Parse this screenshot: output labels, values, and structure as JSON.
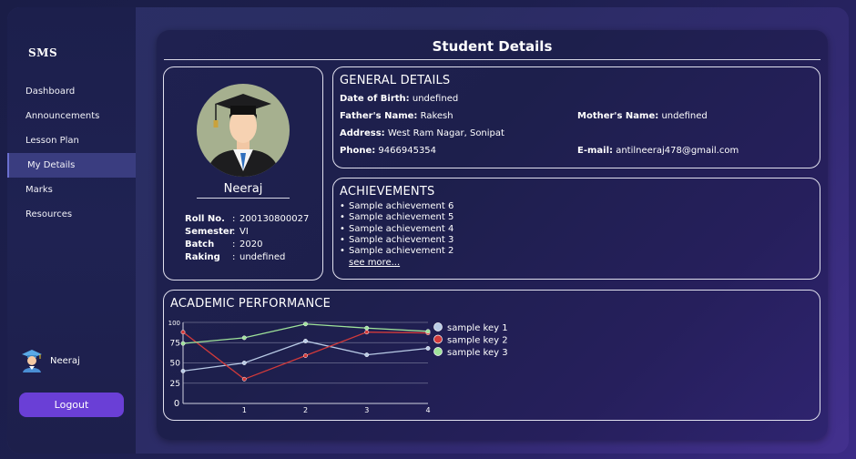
{
  "sidebar": {
    "brand": "SMS",
    "items": [
      {
        "label": "Dashboard"
      },
      {
        "label": "Announcements"
      },
      {
        "label": "Lesson Plan"
      },
      {
        "label": "My Details"
      },
      {
        "label": "Marks"
      },
      {
        "label": "Resources"
      }
    ],
    "active_index": 3,
    "user_name": "Neeraj",
    "logout_label": "Logout"
  },
  "main": {
    "title": "Student Details"
  },
  "profile": {
    "name": "Neeraj",
    "fields": [
      {
        "key": "Roll No.",
        "value": "200130800027"
      },
      {
        "key": "Semester",
        "value": "VI"
      },
      {
        "key": "Batch",
        "value": "2020"
      },
      {
        "key": "Raking",
        "value": "undefined"
      }
    ]
  },
  "general": {
    "heading": "GENERAL DETAILS",
    "dob_label": "Date of Birth:",
    "dob": "undefined",
    "father_label": "Father's Name:",
    "father": "Rakesh",
    "mother_label": "Mother's Name:",
    "mother": "undefined",
    "address_label": "Address:",
    "address": "West Ram Nagar, Sonipat",
    "phone_label": "Phone:",
    "phone": "9466945354",
    "email_label": "E-mail:",
    "email": "antilneeraj478@gmail.com"
  },
  "achievements": {
    "heading": "ACHIEVEMENTS",
    "items": [
      "Sample achievement 6",
      "Sample achievement 5",
      "Sample achievement 4",
      "Sample achievement 3",
      "Sample achievement 2"
    ],
    "see_more": "see more..."
  },
  "performance": {
    "heading": "ACADEMIC PERFORMANCE"
  },
  "colors": {
    "accent": "#6a3fd6",
    "series1": "#b9cbe6",
    "series2": "#d23a3a",
    "series3": "#9fe39a"
  },
  "chart_data": {
    "type": "line",
    "x": [
      0,
      1,
      2,
      3,
      4
    ],
    "xticks": [
      "0",
      "1",
      "2",
      "3",
      "4"
    ],
    "yticks": [
      "25",
      "50",
      "75",
      "100"
    ],
    "ylim": [
      0,
      100
    ],
    "xlim": [
      0,
      4
    ],
    "grid": true,
    "legend": "right",
    "series": [
      {
        "name": "sample key 1",
        "values": [
          40,
          50,
          77,
          60,
          68
        ],
        "color": "#b9cbe6"
      },
      {
        "name": "sample key 2",
        "values": [
          88,
          30,
          59,
          88,
          87
        ],
        "color": "#d23a3a"
      },
      {
        "name": "sample key 3",
        "values": [
          74,
          81,
          98,
          93,
          89
        ],
        "color": "#9fe39a"
      }
    ]
  }
}
